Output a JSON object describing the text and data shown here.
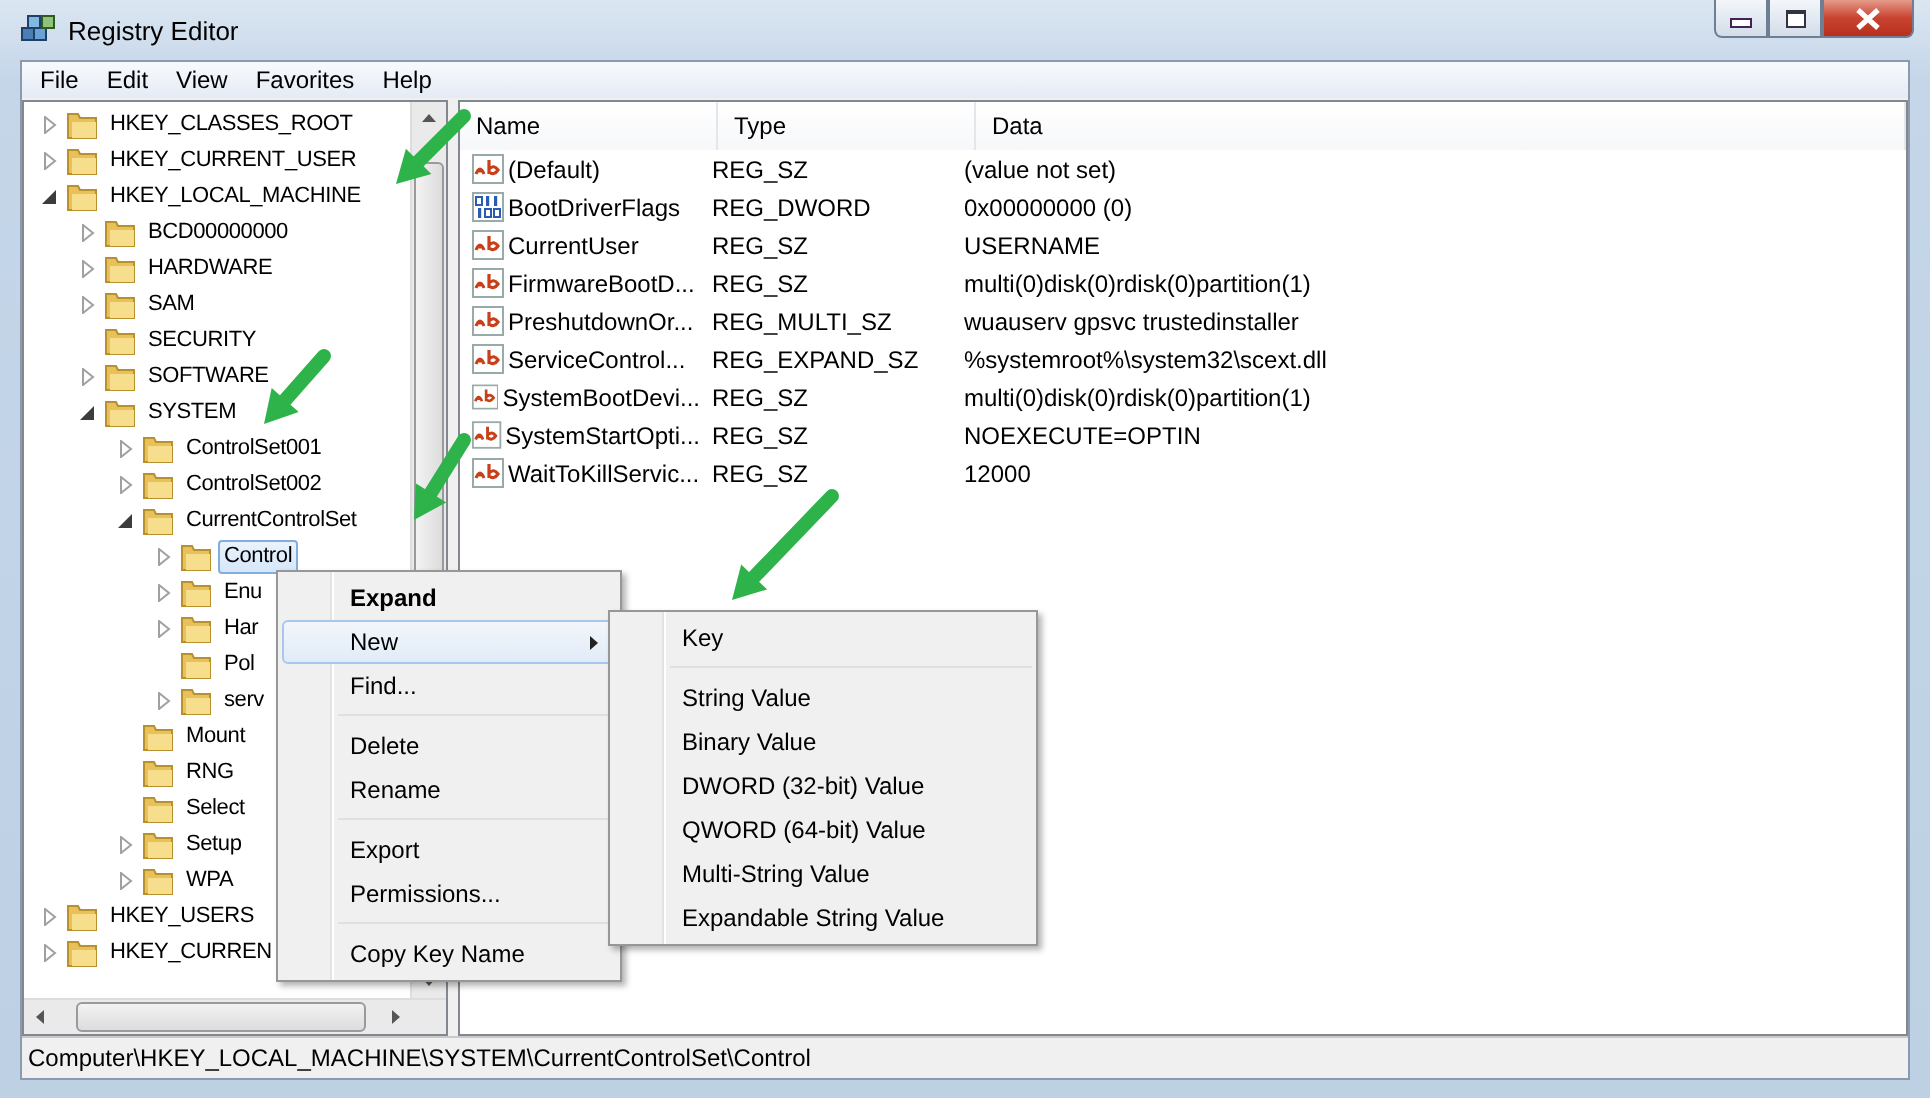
{
  "window": {
    "title": "Registry Editor"
  },
  "menu_bar": [
    "File",
    "Edit",
    "View",
    "Favorites",
    "Help"
  ],
  "tree": [
    {
      "label": "HKEY_CLASSES_ROOT",
      "expanded": false,
      "selected": false
    },
    {
      "label": "HKEY_CURRENT_USER",
      "expanded": false,
      "selected": false
    },
    {
      "label": "HKEY_LOCAL_MACHINE",
      "expanded": true,
      "selected": false,
      "children": [
        {
          "label": "BCD00000000",
          "expanded": false,
          "selected": false
        },
        {
          "label": "HARDWARE",
          "expanded": false,
          "selected": false
        },
        {
          "label": "SAM",
          "expanded": false,
          "selected": false
        },
        {
          "label": "SECURITY",
          "selected": false
        },
        {
          "label": "SOFTWARE",
          "expanded": false,
          "selected": false
        },
        {
          "label": "SYSTEM",
          "expanded": true,
          "selected": false,
          "children": [
            {
              "label": "ControlSet001",
              "expanded": false,
              "selected": false
            },
            {
              "label": "ControlSet002",
              "expanded": false,
              "selected": false
            },
            {
              "label": "CurrentControlSet",
              "expanded": true,
              "selected": false,
              "children": [
                {
                  "label": "Control",
                  "expanded": false,
                  "selected": true
                },
                {
                  "label": "Enu",
                  "expanded": false,
                  "selected": false
                },
                {
                  "label": "Har",
                  "expanded": false,
                  "selected": false
                },
                {
                  "label": "Pol",
                  "selected": false
                },
                {
                  "label": "serv",
                  "expanded": false,
                  "selected": false
                }
              ]
            },
            {
              "label": "Mount",
              "selected": false
            },
            {
              "label": "RNG",
              "selected": false
            },
            {
              "label": "Select",
              "selected": false
            },
            {
              "label": "Setup",
              "expanded": false,
              "selected": false
            },
            {
              "label": "WPA",
              "expanded": false,
              "selected": false
            }
          ]
        }
      ]
    },
    {
      "label": "HKEY_USERS",
      "expanded": false,
      "selected": false
    },
    {
      "label": "HKEY_CURREN",
      "expanded": false,
      "selected": false
    }
  ],
  "values": {
    "columns": [
      "Name",
      "Type",
      "Data"
    ],
    "rows": [
      {
        "kind": "string",
        "name": "(Default)",
        "type": "REG_SZ",
        "data": "(value not set)"
      },
      {
        "kind": "binary",
        "name": "BootDriverFlags",
        "type": "REG_DWORD",
        "data": "0x00000000 (0)"
      },
      {
        "kind": "string",
        "name": "CurrentUser",
        "type": "REG_SZ",
        "data": "USERNAME"
      },
      {
        "kind": "string",
        "name": "FirmwareBootD...",
        "type": "REG_SZ",
        "data": "multi(0)disk(0)rdisk(0)partition(1)"
      },
      {
        "kind": "string",
        "name": "PreshutdownOr...",
        "type": "REG_MULTI_SZ",
        "data": "wuauserv gpsvc trustedinstaller"
      },
      {
        "kind": "string",
        "name": "ServiceControl...",
        "type": "REG_EXPAND_SZ",
        "data": "%systemroot%\\system32\\scext.dll"
      },
      {
        "kind": "string",
        "name": "SystemBootDevi...",
        "type": "REG_SZ",
        "data": "multi(0)disk(0)rdisk(0)partition(1)"
      },
      {
        "kind": "string",
        "name": "SystemStartOpti...",
        "type": "REG_SZ",
        "data": " NOEXECUTE=OPTIN"
      },
      {
        "kind": "string",
        "name": "WaitToKillServic...",
        "type": "REG_SZ",
        "data": "12000"
      }
    ]
  },
  "context_menu": {
    "groups": [
      [
        {
          "label": "Expand",
          "bold": true,
          "selected": false,
          "submenu": false
        },
        {
          "label": "New",
          "bold": false,
          "selected": true,
          "submenu": true
        },
        {
          "label": "Find...",
          "bold": false,
          "selected": false,
          "submenu": false
        }
      ],
      [
        {
          "label": "Delete",
          "bold": false,
          "selected": false,
          "submenu": false
        },
        {
          "label": "Rename",
          "bold": false,
          "selected": false,
          "submenu": false
        }
      ],
      [
        {
          "label": "Export",
          "bold": false,
          "selected": false,
          "submenu": false
        },
        {
          "label": "Permissions...",
          "bold": false,
          "selected": false,
          "submenu": false
        }
      ],
      [
        {
          "label": "Copy Key Name",
          "bold": false,
          "selected": false,
          "submenu": false
        }
      ]
    ]
  },
  "submenu": {
    "groups": [
      [
        "Key"
      ],
      [
        "String Value",
        "Binary Value",
        "DWORD (32-bit) Value",
        "QWORD (64-bit) Value",
        "Multi-String Value",
        "Expandable String Value"
      ]
    ]
  },
  "status_bar": "Computer\\HKEY_LOCAL_MACHINE\\SYSTEM\\CurrentControlSet\\Control"
}
